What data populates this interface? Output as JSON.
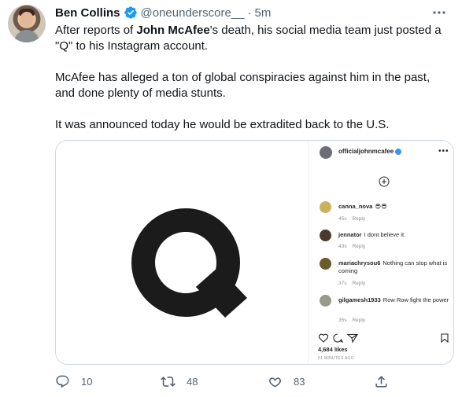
{
  "tweet": {
    "author_name": "Ben Collins",
    "handle": "@oneunderscore__",
    "separator": "·",
    "time": "5m",
    "paragraph1_before": "After reports of ",
    "paragraph1_bold1": "John McAfee",
    "paragraph1_after": "'s death, his social media team just posted a \"Q\" to his Instagram account.",
    "paragraph2": "McAfee has alleged a ton of global conspiracies against him in the past, and done plenty of media stunts.",
    "paragraph3": "It was announced today he would be extradited back to the U.S."
  },
  "media": {
    "q_letter": "Q",
    "instagram": {
      "username": "officialjohnmcafee",
      "more": "•••",
      "comments": [
        {
          "user": "canna_nova",
          "text": "😎😎",
          "age": "45s",
          "reply": "Reply"
        },
        {
          "user": "jennator",
          "text": "I dont believe it.",
          "age": "43s",
          "reply": "Reply"
        },
        {
          "user": "mariachrysou6",
          "text": "Nothing can stop what is coming",
          "age": "37s",
          "reply": "Reply"
        },
        {
          "user": "gilgamesh1933",
          "text": "Row Row fight the power",
          "age": "35s",
          "reply": "Reply"
        }
      ],
      "likes": "4,684 likes",
      "ago": "51 MINUTES AGO"
    }
  },
  "actions": {
    "replies": "10",
    "retweets": "48",
    "likes": "83"
  },
  "colors": {
    "verified": "#1d9bf0",
    "muted": "#536471",
    "text": "#0f1419"
  }
}
